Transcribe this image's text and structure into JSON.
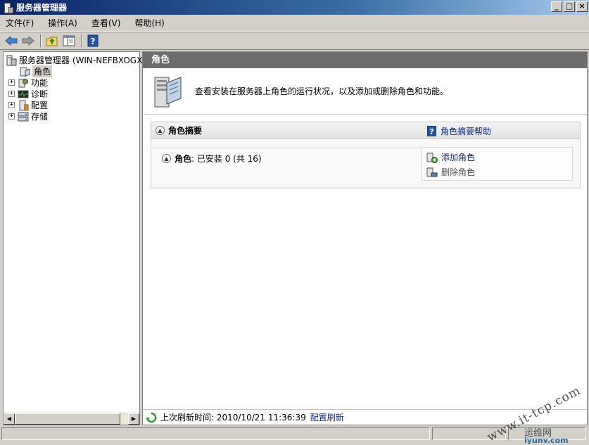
{
  "window": {
    "title": "服务器管理器",
    "buttons": [
      "_",
      "□",
      "×"
    ]
  },
  "menu": [
    {
      "label": "文件(F)"
    },
    {
      "label": "操作(A)"
    },
    {
      "label": "查看(V)"
    },
    {
      "label": "帮助(H)"
    }
  ],
  "toolbar": {
    "icons": [
      "back-arrow-icon",
      "forward-arrow-icon",
      "up-folder-icon",
      "show-hide-tree-icon",
      "help-icon"
    ]
  },
  "tree": {
    "root": "服务器管理器 (WIN-NEFBXOGXNJ",
    "items": [
      {
        "label": "角色",
        "icon": "roles-icon",
        "selected": true,
        "expandable": false
      },
      {
        "label": "功能",
        "icon": "features-icon",
        "expandable": true
      },
      {
        "label": "诊断",
        "icon": "diagnostics-icon",
        "expandable": true
      },
      {
        "label": "配置",
        "icon": "configuration-icon",
        "expandable": true
      },
      {
        "label": "存储",
        "icon": "storage-icon",
        "expandable": true
      }
    ]
  },
  "main": {
    "header": "角色",
    "description": "查看安装在服务器上角色的运行状况，以及添加或删除角色和功能。",
    "summary": {
      "title": "角色摘要",
      "help_link": "角色摘要帮助",
      "roles_label": "角色",
      "roles_value": ": 已安装 0 (共 16)",
      "actions": {
        "add": "添加角色",
        "remove": "删除角色"
      }
    },
    "status": {
      "label": "上次刷新时间: 2010/10/21 11:36:39",
      "refresh_link": "配置刷新"
    }
  },
  "watermark": {
    "url": "www.it-tcp.com",
    "cn": "运维网",
    "site": "iyunv.com"
  },
  "colors": {
    "title_start": "#0a246a",
    "pane_header": "#6d6d6d",
    "link": "#0b2b8c"
  }
}
